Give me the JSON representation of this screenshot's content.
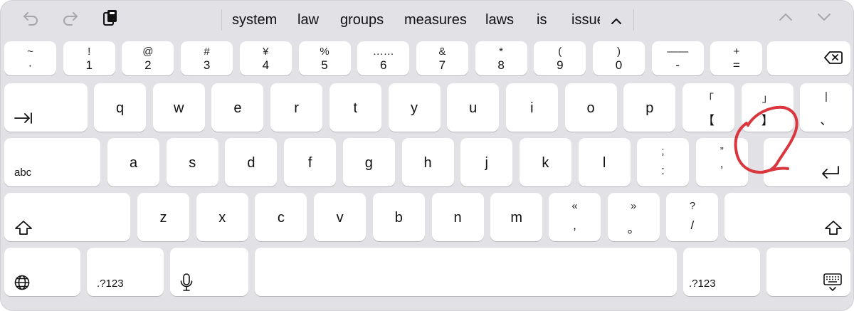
{
  "toolbar": {
    "undo_icon": "undo-arrow-icon",
    "redo_icon": "redo-arrow-icon",
    "paste_icon": "clipboard-icon",
    "suggestions": [
      "system",
      "law",
      "groups",
      "measures",
      "laws",
      "is",
      "issue"
    ],
    "collapse_icon": "chevron-up-icon",
    "prev_icon": "chevron-up-icon",
    "next_icon": "chevron-down-icon"
  },
  "rows": {
    "number": [
      {
        "top": "~",
        "bottom": "·"
      },
      {
        "top": "!",
        "bottom": "1"
      },
      {
        "top": "@",
        "bottom": "2"
      },
      {
        "top": "#",
        "bottom": "3"
      },
      {
        "top": "¥",
        "bottom": "4"
      },
      {
        "top": "%",
        "bottom": "5"
      },
      {
        "top": "……",
        "bottom": "6"
      },
      {
        "top": "&",
        "bottom": "7"
      },
      {
        "top": "*",
        "bottom": "8"
      },
      {
        "top": "(",
        "bottom": "9"
      },
      {
        "top": ")",
        "bottom": "0"
      },
      {
        "top": "——",
        "bottom": "-"
      },
      {
        "top": "+",
        "bottom": "="
      }
    ],
    "qwerty": [
      "q",
      "w",
      "e",
      "r",
      "t",
      "y",
      "u",
      "i",
      "o",
      "p"
    ],
    "qwerty_extra": [
      {
        "top": "「",
        "bottom": "【"
      },
      {
        "top": "」",
        "bottom": "】"
      },
      {
        "top": "|",
        "bottom": "、"
      }
    ],
    "home": [
      "a",
      "s",
      "d",
      "f",
      "g",
      "h",
      "j",
      "k",
      "l"
    ],
    "home_extra": [
      {
        "top": ";",
        "bottom": ":"
      },
      {
        "top": "”",
        "bottom": "’"
      }
    ],
    "bottom_letters": [
      "z",
      "x",
      "c",
      "v",
      "b",
      "n",
      "m"
    ],
    "bottom_extra": [
      {
        "top": "«",
        "bottom": ","
      },
      {
        "top": "»",
        "bottom": "。"
      },
      {
        "top": "?",
        "bottom": "/"
      }
    ]
  },
  "special": {
    "delete_icon": "delete-backspace-icon",
    "tab_icon": "tab-arrow-icon",
    "abc_label": "abc",
    "return_icon": "return-arrow-icon",
    "shift_icon": "shift-arrow-icon",
    "globe_icon": "globe-icon",
    "numbers_label": ".?123",
    "mic_icon": "microphone-icon",
    "hide_keyboard_icon": "keyboard-dismiss-icon"
  },
  "colors": {
    "keyboard_bg": "#e1e1e6",
    "key_bg": "#ffffff",
    "annotation": "#d9363e"
  }
}
